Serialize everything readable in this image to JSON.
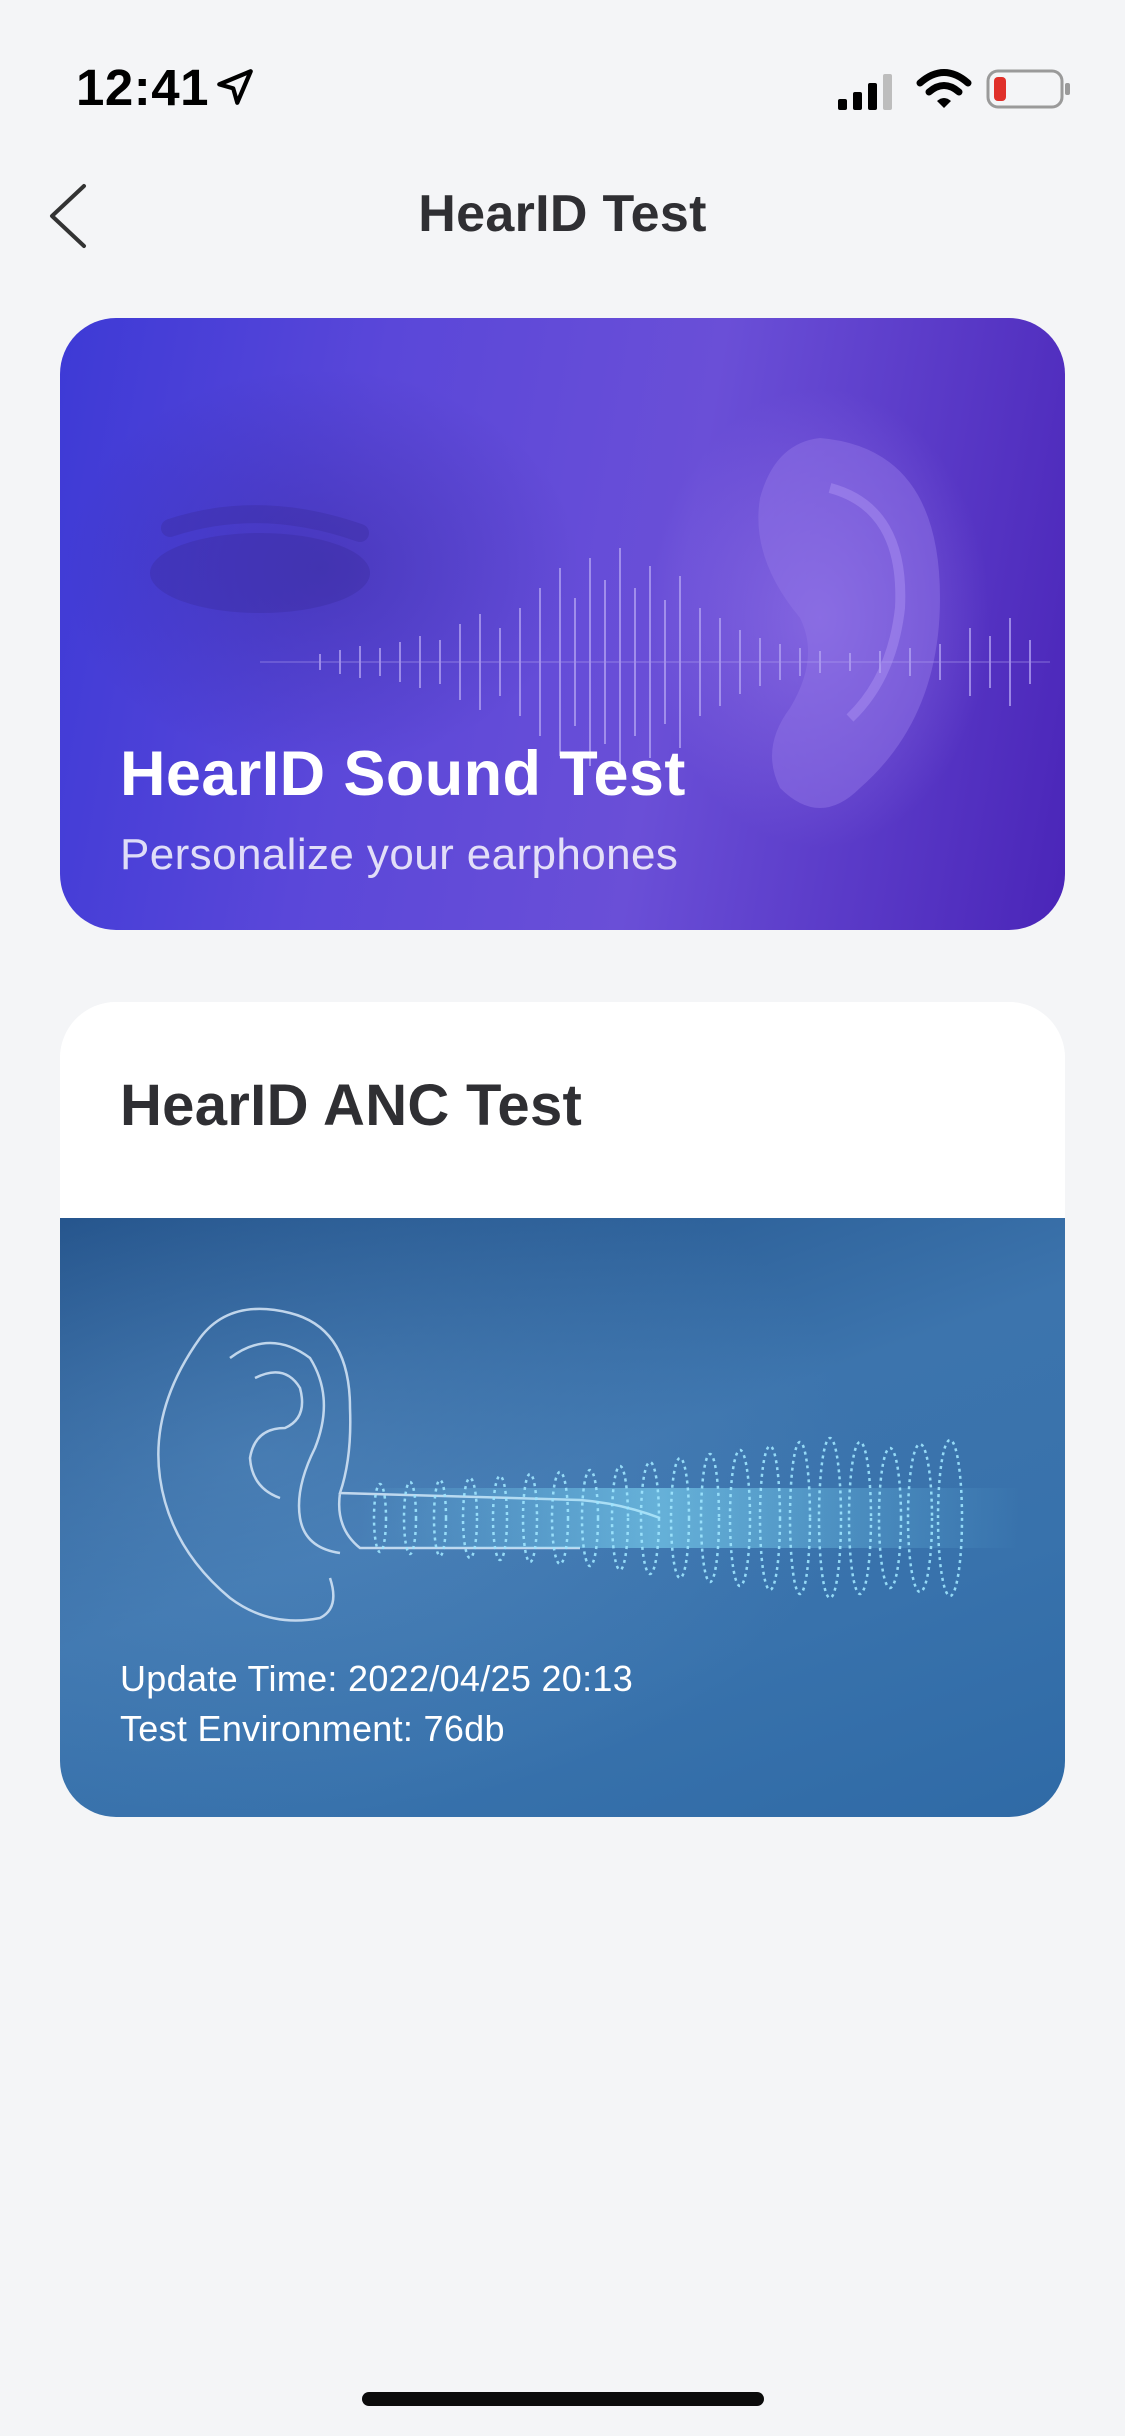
{
  "status_bar": {
    "time": "12:41",
    "icons": [
      "location-arrow-icon",
      "cellular-signal-icon",
      "wifi-icon",
      "battery-low-icon"
    ]
  },
  "nav": {
    "title": "HearID Test",
    "back_icon": "chevron-left-icon"
  },
  "sound_test": {
    "title": "HearID Sound Test",
    "subtitle": "Personalize your earphones"
  },
  "anc_test": {
    "title": "HearID ANC Test",
    "update_time": "Update Time: 2022/04/25 20:13",
    "test_environment": "Test Environment: 76db"
  },
  "colors": {
    "background": "#f4f5f7",
    "sound_card_gradient_start": "#3d3ad6",
    "sound_card_gradient_end": "#4a25b8",
    "anc_image_blue": "#3872ac",
    "battery_low": "#e0302a"
  }
}
